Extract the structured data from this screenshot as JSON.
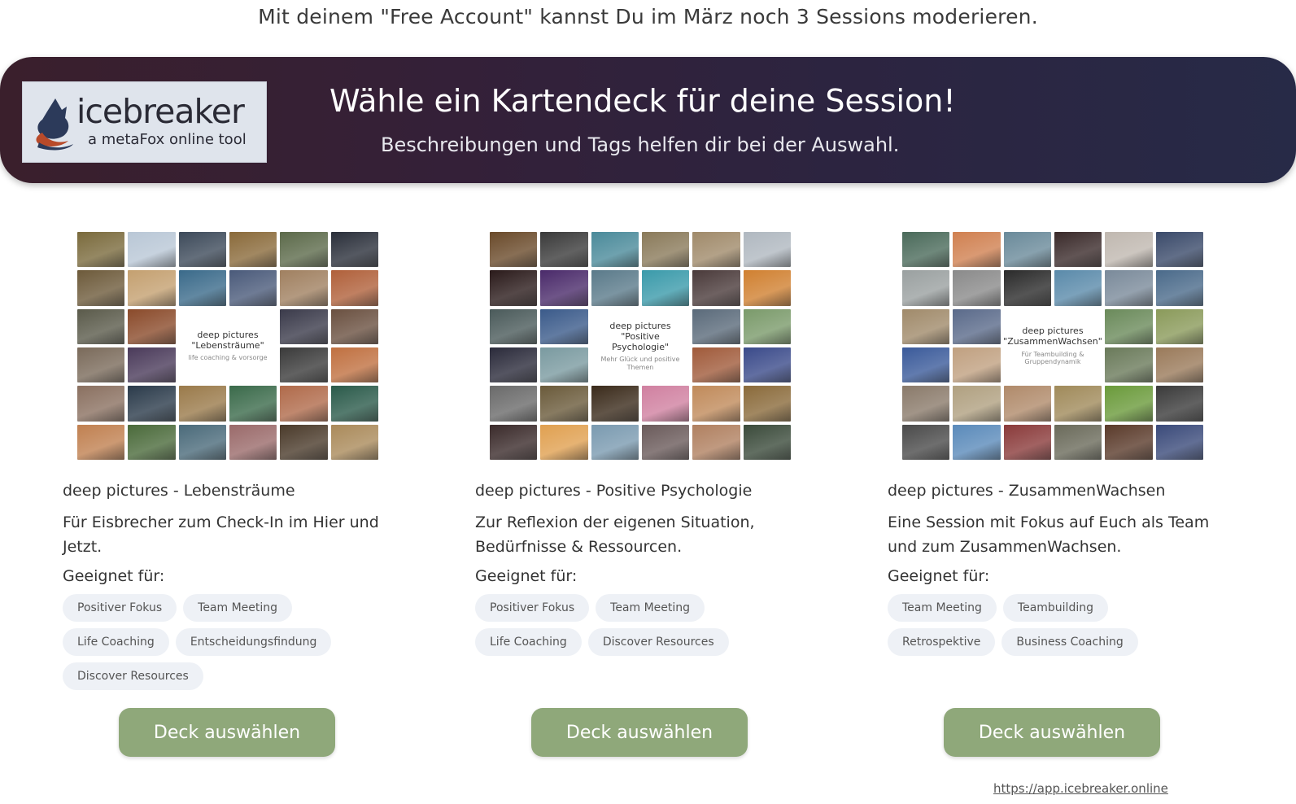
{
  "notice": "Mit deinem \"Free Account\" kannst Du im März noch 3 Sessions moderieren.",
  "banner": {
    "logo_name": "icebreaker",
    "logo_tagline": "a metaFox online tool",
    "title": "Wähle ein Kartendeck für deine Session!",
    "subtitle": "Beschreibungen und Tags helfen dir bei der Auswahl."
  },
  "suited_label": "Geeignet für:",
  "select_button_label": "Deck auswählen",
  "decks": [
    {
      "title": "deep pictures - Lebensträume",
      "description": "Für Eisbrecher zum Check-In im Hier und Jetzt.",
      "card_title": "deep pictures \"Lebensträume\"",
      "card_subtitle": "life coaching & vorsorge",
      "tags": [
        "Positiver Fokus",
        "Team Meeting",
        "Life Coaching",
        "Entscheidungsfindung",
        "Discover Resources"
      ]
    },
    {
      "title": "deep pictures - Positive Psychologie",
      "description": "Zur Reflexion der eigenen Situation, Bedürfnisse & Ressourcen.",
      "card_title": "deep pictures \"Positive Psychologie\"",
      "card_subtitle": "Mehr Glück und positive Themen",
      "tags": [
        "Positiver Fokus",
        "Team Meeting",
        "Life Coaching",
        "Discover Resources"
      ]
    },
    {
      "title": "deep pictures - ZusammenWachsen",
      "description": "Eine Session mit Fokus auf Euch als Team und zum ZusammenWachsen.",
      "card_title": "deep pictures \"ZusammenWachsen\"",
      "card_subtitle": "Für Teambuilding & Gruppendynamik",
      "tags": [
        "Team Meeting",
        "Teambuilding",
        "Retrospektive",
        "Business Coaching"
      ]
    }
  ],
  "footer_url": "https://app.icebreaker.online",
  "colors": {
    "banner_start": "#3a1f2c",
    "banner_end": "#272a47",
    "button": "#8fa87a",
    "tag_bg": "#eef1f6"
  },
  "tile_palettes": [
    [
      "#7a6a3c",
      "#b9c7d6",
      "#3d4a5a",
      "#8a6a3a",
      "#5c6a4a",
      "#2a2f3a",
      "#6d5a3a",
      "#c4a070",
      "#3a6a8a",
      "#4a5a7a",
      "#a08060",
      "#b0603a",
      "#5a5a4a",
      "#8a4a2a",
      "#3a3a4a",
      "#6a5040",
      "#7a6a5a",
      "#4a3a5a",
      "#3a3a3a",
      "#c07040",
      "#8a7060",
      "#2a3a4a",
      "#9a7a4a",
      "#3a6a4a",
      "#b06a4a",
      "#2a5a4a",
      "#c08050",
      "#4a6a3a",
      "#4a6a7a",
      "#9a6a6a",
      "#4a3a2a",
      "#aa8a5a",
      "#2a3a5a",
      "#7a7a5a",
      "#5a8a6a",
      "#3a5a7a"
    ],
    [
      "#6a4a2a",
      "#3a3a3a",
      "#4a8a9a",
      "#8a7a5a",
      "#a08a6a",
      "#b0b8c0",
      "#2a1a1a",
      "#4a2a6a",
      "#5a7a8a",
      "#3a9aaa",
      "#4a3a3a",
      "#d08030",
      "#4a5a5a",
      "#3a5a8a",
      "#5a6a7a",
      "#7a9a6a",
      "#2a2a3a",
      "#7a9aa0",
      "#a05a3a",
      "#3a4a8a",
      "#6a6a6a",
      "#6a5a3a",
      "#3a2a1a",
      "#d080a0",
      "#c08a5a",
      "#8a6a3a",
      "#3a2a2a",
      "#e0a050",
      "#7a9ab0",
      "#6a5a5a",
      "#b08060",
      "#3a4a3a",
      "#8a7a6a",
      "#5a7a9a",
      "#7a6a4a",
      "#2a2a2a"
    ],
    [
      "#4a6a5a",
      "#d08050",
      "#6a8a9a",
      "#3a2a2a",
      "#c0b8b0",
      "#3a4a6a",
      "#9aa0a0",
      "#8a8a8a",
      "#2a2a2a",
      "#5a8aaa",
      "#7a8a9a",
      "#4a6a8a",
      "#a08a6a",
      "#5a6a8a",
      "#6a8a5a",
      "#8a9a5a",
      "#3a5a9a",
      "#c0a080",
      "#6a7a5a",
      "#9a7a5a",
      "#8a7a6a",
      "#b0a080",
      "#b08a6a",
      "#a08a5a",
      "#6a9a3a",
      "#3a3a3a",
      "#4a4a4a",
      "#5a8aba",
      "#8a3a3a",
      "#6a6a5a",
      "#5a3a2a",
      "#3a4a7a",
      "#8a7a4a",
      "#7a5a3a",
      "#2a6a3a",
      "#1a1a2a"
    ]
  ]
}
